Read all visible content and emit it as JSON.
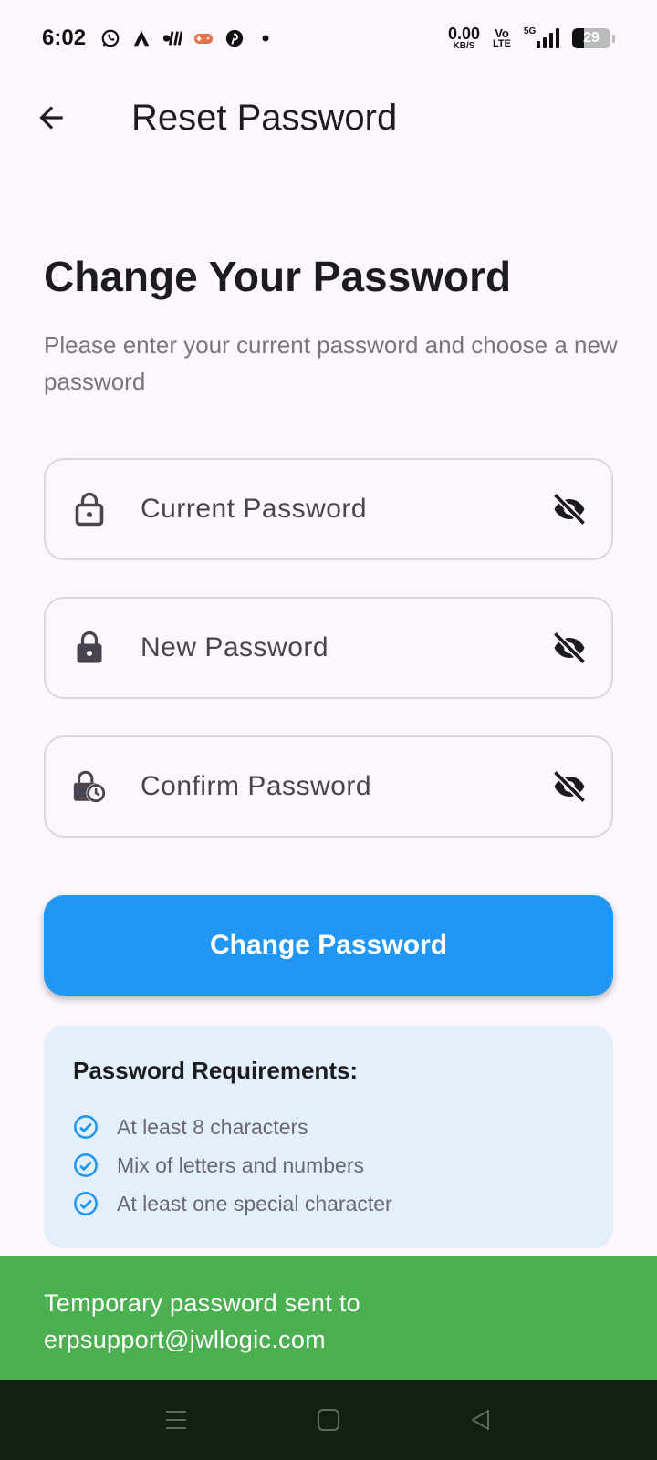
{
  "status_bar": {
    "time": "6:02",
    "net_speed_value": "0.00",
    "net_speed_unit": "KB/S",
    "volte_top": "Vo",
    "volte_bottom": "LTE",
    "network_tag": "5G",
    "battery_level": "29",
    "left_icons": [
      "whatsapp-icon",
      "app-a-icon",
      "app-bars-icon",
      "game-icon",
      "pinterest-icon",
      "dot-icon"
    ]
  },
  "app_bar": {
    "title": "Reset Password",
    "back_icon": "arrow-back-icon"
  },
  "main": {
    "headline": "Change Your Password",
    "subtext": "Please enter your current password and choose a new password",
    "fields": {
      "current": {
        "placeholder": "Current Password",
        "value": "",
        "icon": "lock-outline-icon",
        "toggle_icon": "visibility-off-icon"
      },
      "new": {
        "placeholder": "New Password",
        "value": "",
        "icon": "lock-icon",
        "toggle_icon": "visibility-off-icon"
      },
      "confirm": {
        "placeholder": "Confirm Password",
        "value": "",
        "icon": "lock-clock-icon",
        "toggle_icon": "visibility-off-icon"
      }
    },
    "submit_label": "Change Password"
  },
  "requirements": {
    "title": "Password Requirements:",
    "items": [
      "At least 8 characters",
      "Mix of letters and numbers",
      "At least one special character"
    ]
  },
  "snackbar": {
    "message": "Temporary password sent to erpsupport@jwllogic.com"
  },
  "nav_bar": {
    "buttons": [
      "menu-icon",
      "home-square-icon",
      "back-triangle-icon"
    ]
  },
  "colors": {
    "background": "#fdf7fd",
    "primary": "#2196f3",
    "card": "#e3f0fb",
    "snackbar": "#4caf50",
    "nav": "#0f2212",
    "check": "#2196f3"
  }
}
